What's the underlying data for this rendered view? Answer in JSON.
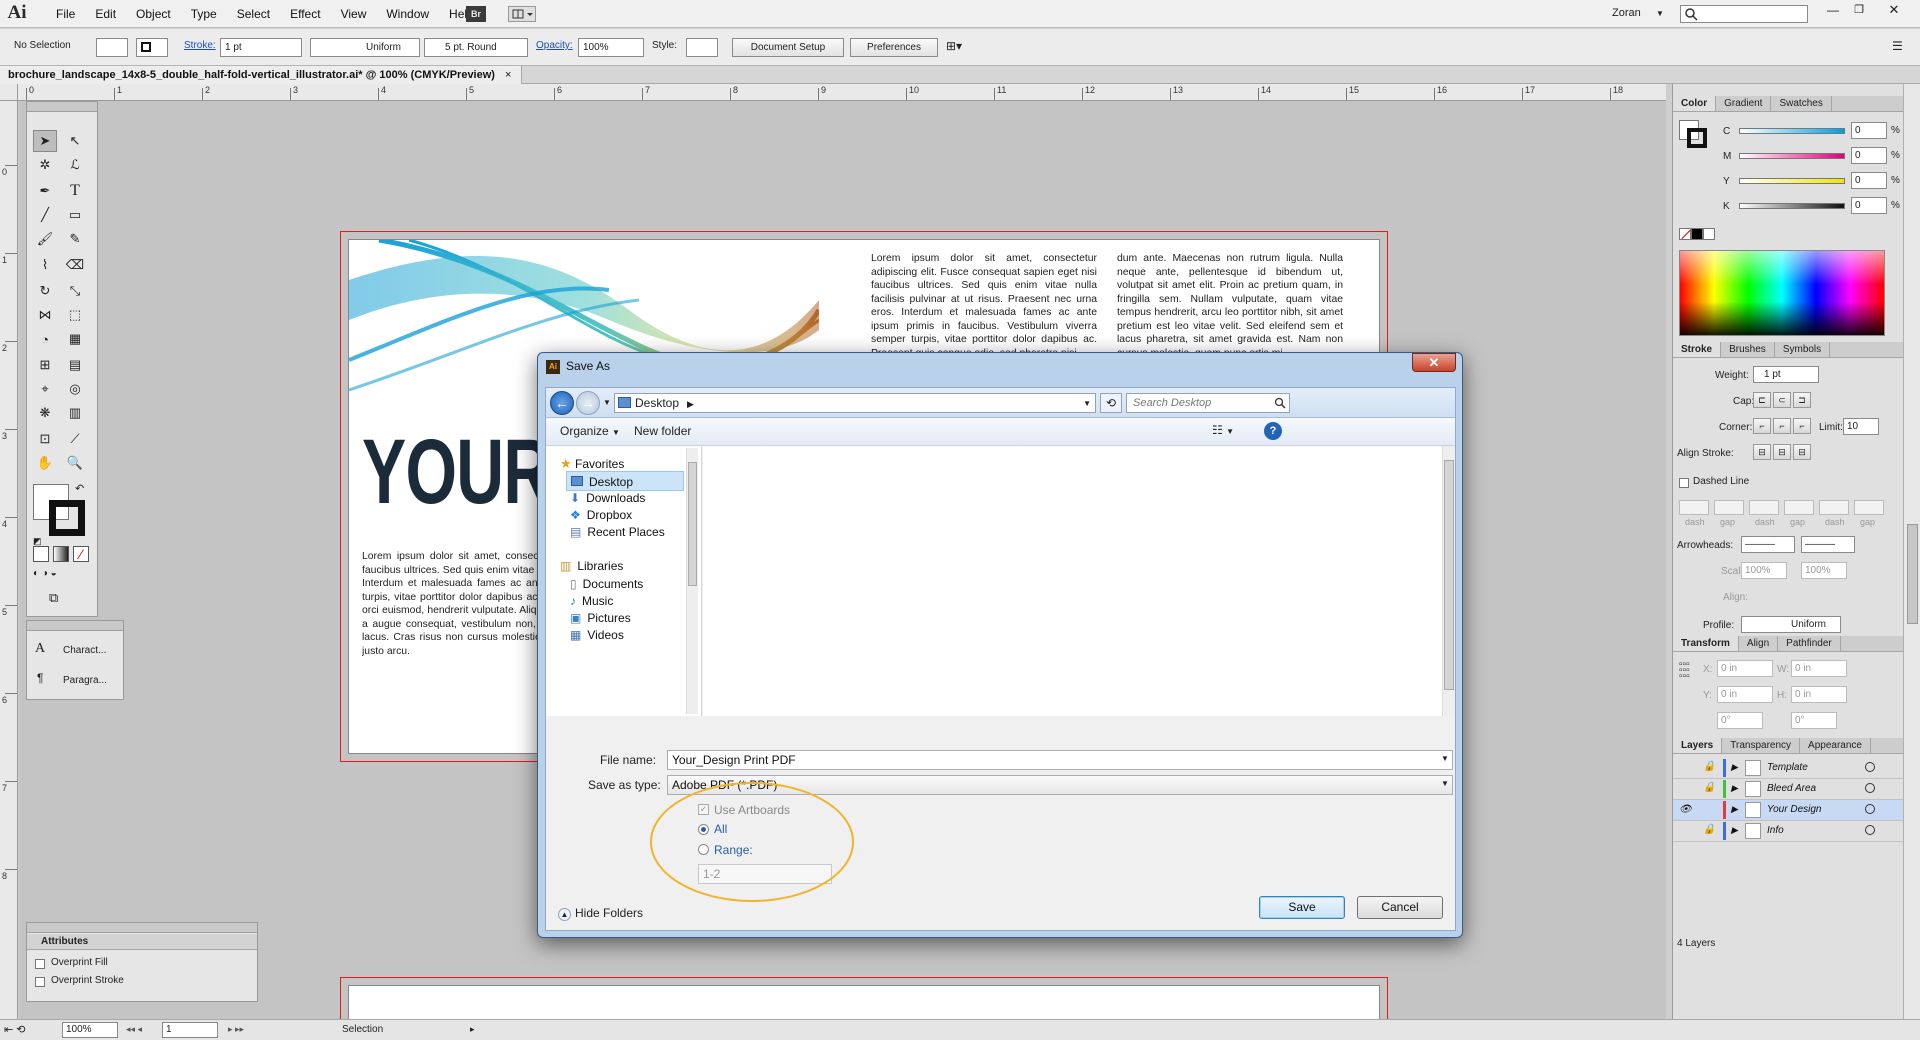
{
  "app": {
    "logo": "Ai",
    "user": "Zoran",
    "menus": [
      "File",
      "Edit",
      "Object",
      "Type",
      "Select",
      "Effect",
      "View",
      "Window",
      "Help"
    ],
    "bridge_label": "Br"
  },
  "control": {
    "selection": "No Selection",
    "stroke_label": "Stroke:",
    "stroke_weight": "1 pt",
    "profile": "Uniform",
    "brush": "5 pt. Round",
    "opacity_label": "Opacity:",
    "opacity": "100%",
    "style_label": "Style:",
    "doc_setup": "Document Setup",
    "preferences": "Preferences"
  },
  "document": {
    "tab_title": "brochure_landscape_14x8-5_double_half-fold-vertical_illustrator.ai* @ 100% (CMYK/Preview)"
  },
  "ruler": {
    "h": [
      "0",
      "1",
      "2",
      "3",
      "4",
      "5",
      "6",
      "7",
      "8",
      "9",
      "10",
      "11",
      "12",
      "13",
      "14",
      "15",
      "16",
      "17",
      "18"
    ],
    "v": [
      "0",
      "1",
      "2",
      "3",
      "4",
      "5",
      "6",
      "7",
      "8"
    ]
  },
  "artwork": {
    "title": "YOUR D",
    "col1": "Lorem ipsum dolor sit amet, consectetur adipiscing elit. Fusce consequat sapien eget nisi faucibus ultrices. Sed quis enim vitae nulla facilisis pulvinar at ut risus. Praesent nec urna eros. Interdum et malesuada fames ac ante ipsum primis in faucibus. Vestibulum viverra semper turpis, vitae porttitor dolor dapibus ac. Praesent quis congue odio, sed pharetra nisi. Etiam ut orci euismod, hendrerit vulputate. Aliquam ut purus suada, tincidunt magna at, vulputate. Etiam a augue consequat, vestibulum non, aliquam ligula. Nulla vitae erat turpis. Donec ut massa lacus. Cras risus non cursus molestie, quam nunc ortis mi, id ornare sem velit eget sit amet justo arcu.",
    "col2": "Lorem ipsum dolor sit amet, consectetur adipiscing elit. Fusce consequat sapien eget nisi faucibus ultrices. Sed quis enim vitae nulla facilisis pulvinar at ut risus. Praesent nec urna eros. Interdum et malesuada fames ac ante ipsum primis in faucibus. Vestibulum viverra semper turpis, vitae porttitor dolor dapibus ac. Praesent quis congue odio, sed pharetra nisi.",
    "col3": "dum ante. Maecenas non rutrum ligula. Nulla neque ante, pellentesque id bibendum ut, volutpat sit amet elit. Proin ac pretium quam, in fringilla sem. Nullam vulputate, quam vitae tempus hendrerit, arcu leo porttitor nibh, sit amet pretium est leo vitae velit. Sed eleifend sem et lacus pharetra, sit amet gravida est. Nam non cursus molestie, quam nunc ortis mi."
  },
  "panels": {
    "char_label": "Charact...",
    "para_label": "Paragra...",
    "attributes_title": "Attributes",
    "overprint_fill": "Overprint Fill",
    "overprint_stroke": "Overprint Stroke"
  },
  "color_panel": {
    "tabs": [
      "Color",
      "Gradient",
      "Swatches"
    ],
    "channels": [
      {
        "label": "C",
        "value": "0"
      },
      {
        "label": "M",
        "value": "0"
      },
      {
        "label": "Y",
        "value": "0"
      },
      {
        "label": "K",
        "value": "0"
      }
    ],
    "unit": "%"
  },
  "stroke_panel": {
    "tabs": [
      "Stroke",
      "Brushes",
      "Symbols"
    ],
    "weight_label": "Weight:",
    "weight": "1 pt",
    "cap_label": "Cap:",
    "corner_label": "Corner:",
    "limit_label": "Limit:",
    "limit": "10",
    "align_label": "Align Stroke:",
    "dashed_label": "Dashed Line",
    "dash_labels": [
      "dash",
      "gap",
      "dash",
      "gap",
      "dash",
      "gap"
    ],
    "arrowheads_label": "Arrowheads:",
    "scale_label": "Scale:",
    "scale1": "100%",
    "scale2": "100%",
    "align2_label": "Align:",
    "profile_label": "Profile:",
    "profile": "Uniform"
  },
  "transform_panel": {
    "tabs": [
      "Transform",
      "Align",
      "Pathfinder"
    ],
    "x_label": "X:",
    "x": "0 in",
    "y_label": "Y:",
    "y": "0 in",
    "w_label": "W:",
    "w": "0 in",
    "h_label": "H:",
    "h": "0 in",
    "rot": "0°",
    "shear": "0°"
  },
  "layers_panel": {
    "tabs": [
      "Layers",
      "Transparency",
      "Appearance"
    ],
    "layers": [
      {
        "name": "Template",
        "color": "#3f6be0"
      },
      {
        "name": "Bleed Area",
        "color": "#3cc43c"
      },
      {
        "name": "Your Design",
        "color": "#e03c3c"
      },
      {
        "name": "Info",
        "color": "#3f6be0"
      }
    ],
    "count": "4 Layers"
  },
  "status": {
    "zoom": "100%",
    "page": "1",
    "tool": "Selection"
  },
  "dialog": {
    "title": "Save As",
    "location": "Desktop",
    "search_placeholder": "Search Desktop",
    "organize": "Organize",
    "new_folder": "New folder",
    "favorites_label": "Favorites",
    "favorites": [
      "Desktop",
      "Downloads",
      "Dropbox",
      "Recent Places"
    ],
    "libraries_label": "Libraries",
    "libraries": [
      "Documents",
      "Music",
      "Pictures",
      "Videos"
    ],
    "filename_label": "File name:",
    "filename": "Your_Design Print PDF",
    "savetype_label": "Save as type:",
    "savetype": "Adobe PDF (*.PDF)",
    "use_artboards": "Use Artboards",
    "all_label": "All",
    "range_label": "Range:",
    "range_value": "1-2",
    "hide_folders": "Hide Folders",
    "save": "Save",
    "cancel": "Cancel"
  }
}
